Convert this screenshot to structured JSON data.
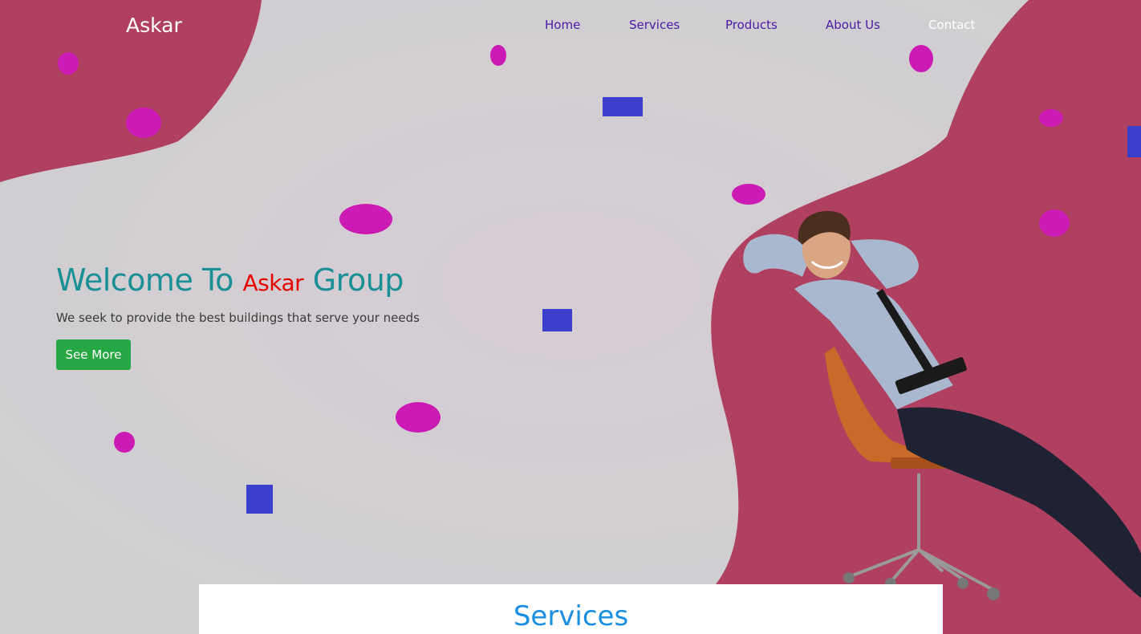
{
  "header": {
    "brand": "Askar",
    "nav": [
      {
        "label": "Home",
        "active": false
      },
      {
        "label": "Services",
        "active": false
      },
      {
        "label": "Products",
        "active": false
      },
      {
        "label": "About Us",
        "active": false
      },
      {
        "label": "Contact",
        "active": true
      }
    ]
  },
  "hero": {
    "title_prefix": "Welcome To ",
    "title_accent": "Askar",
    "title_suffix": " Group",
    "subtitle": "We seek to provide the best buildings that serve your needs",
    "cta_label": "See More"
  },
  "services": {
    "heading": "Services"
  },
  "colors": {
    "background": "#d0d0d2",
    "blob": "#b04060",
    "magenta_dot": "#cc1ab5",
    "blue_square": "#3a3fcc",
    "hero_title": "#1a8f96",
    "hero_accent": "#e60000",
    "cta": "#28a745",
    "nav_link": "#4a1aa6",
    "services_heading": "#1a8fe0"
  },
  "hero_image": {
    "subject": "man-relaxing-in-office-chair"
  }
}
